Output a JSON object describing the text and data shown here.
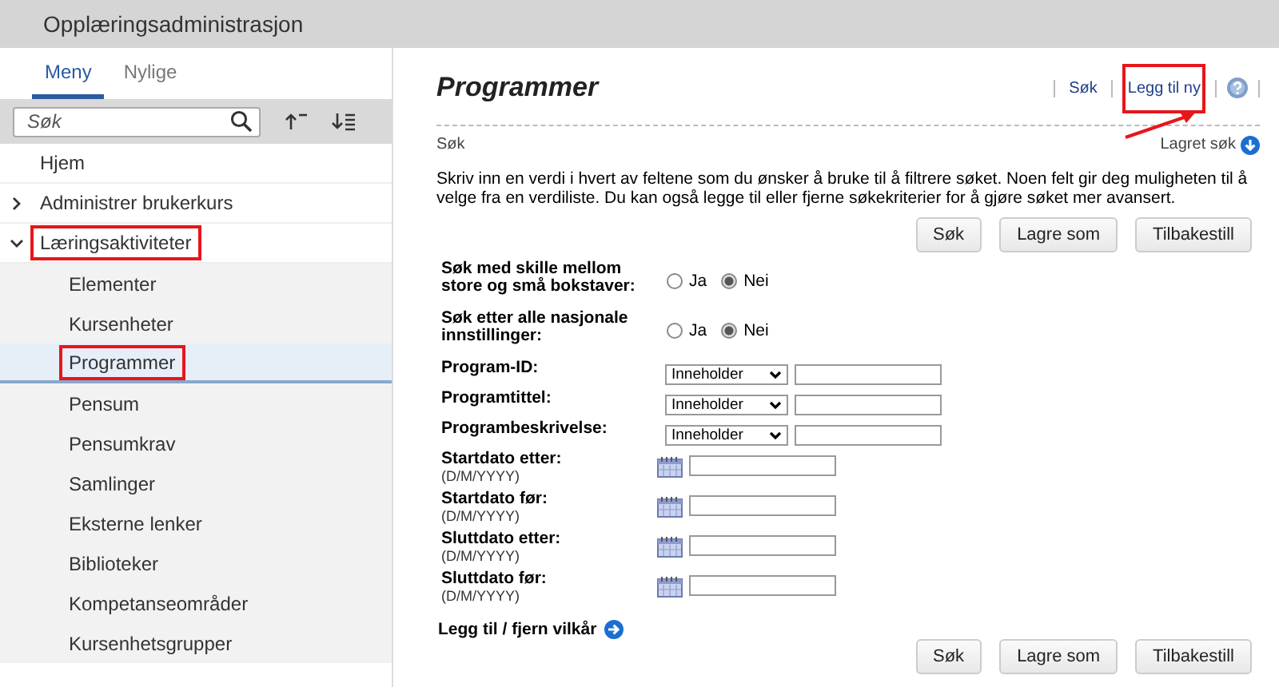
{
  "app_title": "Opplæringsadministrasjon",
  "sidebar": {
    "tabs": [
      {
        "label": "Meny",
        "selected": true
      },
      {
        "label": "Nylige",
        "selected": false
      }
    ],
    "search": {
      "placeholder": "Søk"
    },
    "items": [
      {
        "label": "Hjem",
        "highlighted": false
      },
      {
        "label": "Administrer brukerkurs",
        "expanded": false,
        "highlighted": false
      },
      {
        "label": "Læringsaktiviteter",
        "expanded": true,
        "highlighted": true,
        "children": [
          {
            "label": "Elementer",
            "highlighted": false,
            "selected": false
          },
          {
            "label": "Kursenheter",
            "highlighted": false,
            "selected": false
          },
          {
            "label": "Programmer",
            "highlighted": true,
            "selected": true
          },
          {
            "label": "Pensum",
            "highlighted": false,
            "selected": false
          },
          {
            "label": "Pensumkrav",
            "highlighted": false,
            "selected": false
          },
          {
            "label": "Samlinger",
            "highlighted": false,
            "selected": false
          },
          {
            "label": "Eksterne lenker",
            "highlighted": false,
            "selected": false
          },
          {
            "label": "Biblioteker",
            "highlighted": false,
            "selected": false
          },
          {
            "label": "Kompetanseområder",
            "highlighted": false,
            "selected": false
          },
          {
            "label": "Kursenhetsgrupper",
            "highlighted": false,
            "selected": false
          }
        ]
      }
    ]
  },
  "page": {
    "title": "Programmer",
    "links": [
      {
        "label": "Søk",
        "highlighted": false
      },
      {
        "label": "Legg til ny",
        "highlighted": true
      }
    ],
    "pointer_arrow": true,
    "section_label": "Søk",
    "saved_search": "Lagret søk",
    "instructions": "Skriv inn en verdi i hvert av feltene som du ønsker å bruke til å filtrere søket. Noen felt gir deg muligheten til å velge fra en verdiliste. Du kan også legge til eller fjerne søkekriterier for å gjøre søket mer avansert.",
    "top_buttons": [
      "Søk",
      "Lagre som",
      "Tilbakestill"
    ],
    "fields": [
      {
        "kind": "radio",
        "label": "Søk med skille mellom store og små bokstaver:",
        "options": [
          {
            "label": "Ja",
            "selected": false
          },
          {
            "label": "Nei",
            "selected": true
          }
        ]
      },
      {
        "kind": "radio",
        "label": "Søk etter alle nasjonale innstillinger:",
        "options": [
          {
            "label": "Ja",
            "selected": false
          },
          {
            "label": "Nei",
            "selected": true
          }
        ]
      },
      {
        "kind": "select",
        "label": "Program-ID:",
        "operator": "Inneholder"
      },
      {
        "kind": "select",
        "label": "Programtittel:",
        "operator": "Inneholder"
      },
      {
        "kind": "select",
        "label": "Programbeskrivelse:",
        "operator": "Inneholder"
      },
      {
        "kind": "date",
        "label": "Startdato etter:",
        "hint": "(D/M/YYYY)"
      },
      {
        "kind": "date",
        "label": "Startdato før:",
        "hint": "(D/M/YYYY)"
      },
      {
        "kind": "date",
        "label": "Sluttdato etter:",
        "hint": "(D/M/YYYY)"
      },
      {
        "kind": "date",
        "label": "Sluttdato før:",
        "hint": "(D/M/YYYY)"
      }
    ],
    "add_remove_link": "Legg til / fjern vilkår",
    "bottom_buttons": [
      "Søk",
      "Lagre som",
      "Tilbakestill"
    ]
  }
}
